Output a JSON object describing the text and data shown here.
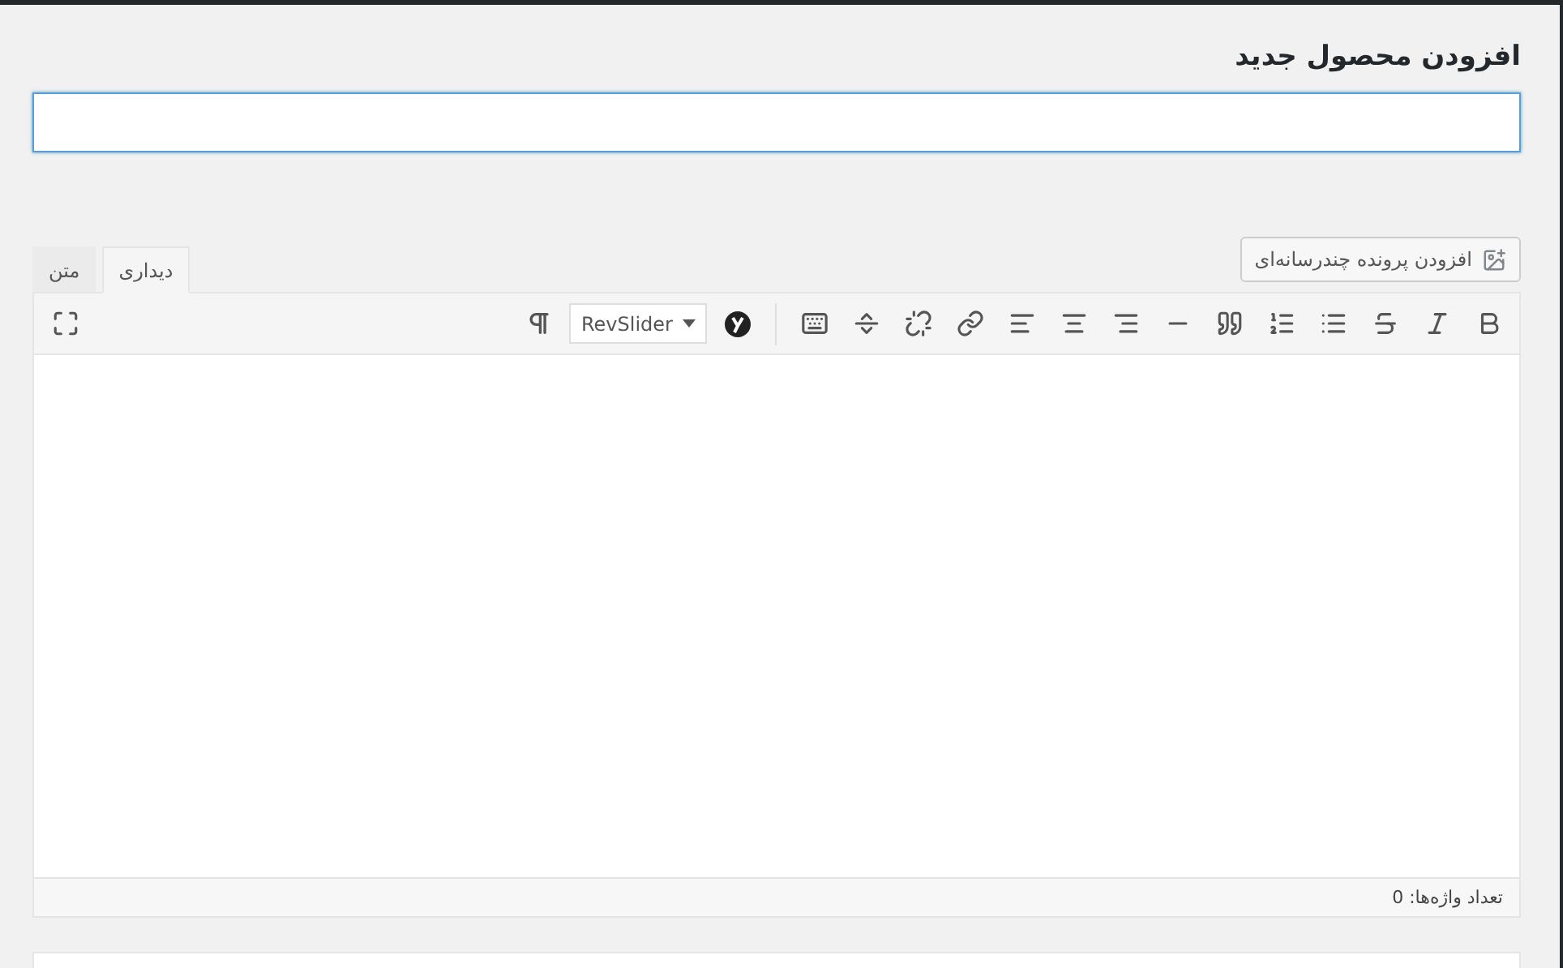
{
  "page_title": "افزودن محصول جدید",
  "media_button": {
    "label": "افزودن پرونده چندرسانه‌ای"
  },
  "tabs": [
    {
      "label": "دیداری",
      "selected": true
    },
    {
      "label": "متن",
      "selected": false
    }
  ],
  "toolbar": {
    "dropdown": "RevSlider"
  },
  "status_bar": {
    "word_count": "تعداد واژه‌ها: 0"
  }
}
